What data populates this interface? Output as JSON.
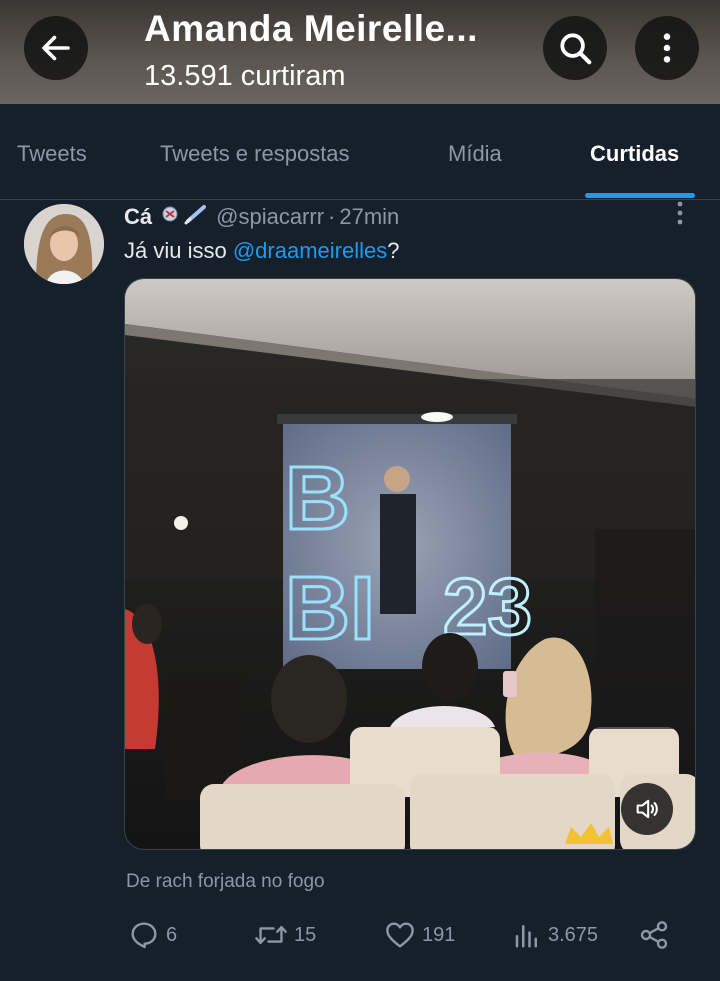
{
  "header": {
    "title": "Amanda Meirelle...",
    "subtitle": "13.591 curtiram"
  },
  "tabs": [
    {
      "label": "Tweets",
      "active": false
    },
    {
      "label": "Tweets e respostas",
      "active": false
    },
    {
      "label": "Mídia",
      "active": false
    },
    {
      "label": "Curtidas",
      "active": true
    }
  ],
  "tweet": {
    "display_name": "Cá",
    "handle": "@spiacarrr",
    "separator": "·",
    "time": "27min",
    "text_before": "Já viu isso ",
    "mention": "@draameirelles",
    "text_after": "?",
    "caption": "De  rach forjada no fogo",
    "actions": {
      "replies": "6",
      "retweets": "15",
      "likes": "191",
      "views": "3.675"
    }
  },
  "colors": {
    "background": "#15202b",
    "accent": "#1d9bf0",
    "muted": "#8b98a5"
  },
  "icons": [
    "back-arrow-icon",
    "search-icon",
    "more-vertical-icon",
    "volume-icon",
    "reply-icon",
    "retweet-icon",
    "like-icon",
    "views-icon",
    "share-icon"
  ]
}
